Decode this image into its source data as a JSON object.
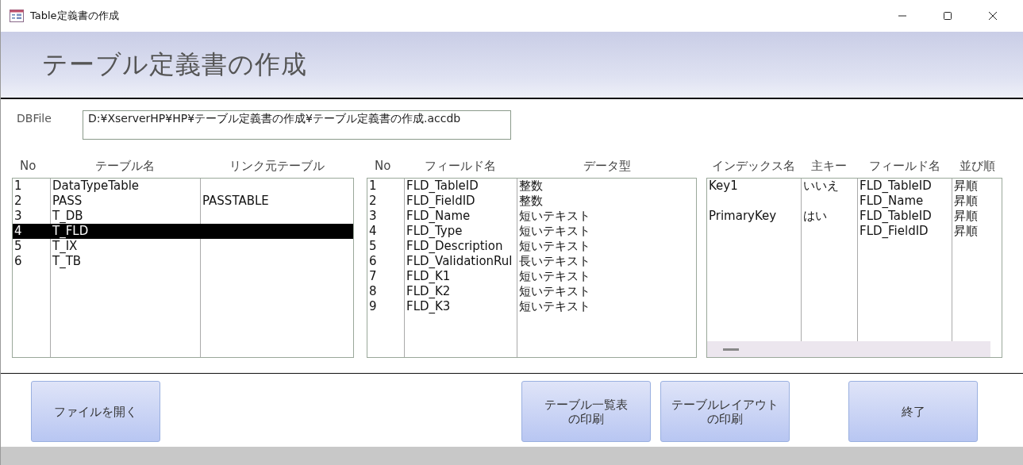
{
  "window": {
    "title": "Table定義書の作成"
  },
  "header": {
    "title": "テーブル定義書の作成"
  },
  "db_file": {
    "label": "DBFile",
    "value": "D:¥XserverHP¥HP¥テーブル定義書の作成¥テーブル定義書の作成.accdb"
  },
  "tables": {
    "columns": [
      "No",
      "テーブル名",
      "リンク元テーブル"
    ],
    "rows": [
      {
        "no": "1",
        "name": "DataTypeTable",
        "link": "",
        "selected": false
      },
      {
        "no": "2",
        "name": "PASS",
        "link": "PASSTABLE",
        "selected": false
      },
      {
        "no": "3",
        "name": "T_DB",
        "link": "",
        "selected": false
      },
      {
        "no": "4",
        "name": "T_FLD",
        "link": "",
        "selected": true
      },
      {
        "no": "5",
        "name": "T_IX",
        "link": "",
        "selected": false
      },
      {
        "no": "6",
        "name": "T_TB",
        "link": "",
        "selected": false
      }
    ]
  },
  "fields": {
    "columns": [
      "No",
      "フィールド名",
      "データ型"
    ],
    "rows": [
      {
        "no": "1",
        "name": "FLD_TableID",
        "type": "整数"
      },
      {
        "no": "2",
        "name": "FLD_FieldID",
        "type": "整数"
      },
      {
        "no": "3",
        "name": "FLD_Name",
        "type": "短いテキスト"
      },
      {
        "no": "4",
        "name": "FLD_Type",
        "type": "短いテキスト"
      },
      {
        "no": "5",
        "name": "FLD_Description",
        "type": "短いテキスト"
      },
      {
        "no": "6",
        "name": "FLD_ValidationRul",
        "type": "長いテキスト"
      },
      {
        "no": "7",
        "name": "FLD_K1",
        "type": "短いテキスト"
      },
      {
        "no": "8",
        "name": "FLD_K2",
        "type": "短いテキスト"
      },
      {
        "no": "9",
        "name": "FLD_K3",
        "type": "短いテキスト"
      }
    ]
  },
  "indexes": {
    "columns": [
      "インデックス名",
      "主キー",
      "フィールド名",
      "並び順"
    ],
    "rows": [
      {
        "name": "Key1",
        "primary": "いいえ",
        "fields": [
          {
            "field": "FLD_TableID",
            "order": "昇順"
          },
          {
            "field": "FLD_Name",
            "order": "昇順"
          }
        ]
      },
      {
        "name": "PrimaryKey",
        "primary": "はい",
        "fields": [
          {
            "field": "FLD_TableID",
            "order": "昇順"
          },
          {
            "field": "FLD_FieldID",
            "order": "昇順"
          }
        ]
      }
    ]
  },
  "buttons": [
    {
      "label": "ファイルを開く",
      "kind": "left"
    },
    {
      "label": "テーブル一覧表の印刷",
      "kind": "right"
    },
    {
      "label": "テーブルレイアウトの印刷",
      "kind": "right"
    },
    {
      "label": "終了",
      "kind": "end"
    }
  ]
}
